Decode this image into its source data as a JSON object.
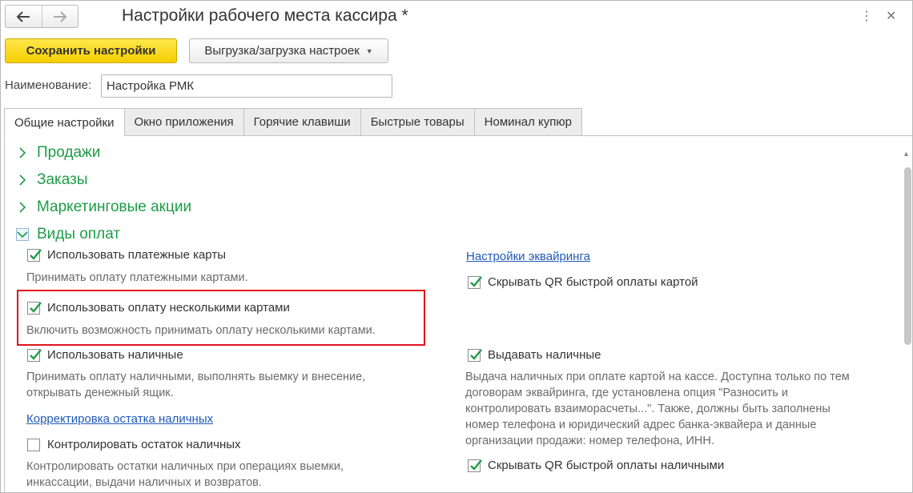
{
  "window": {
    "title": "Настройки рабочего места кассира *",
    "more_glyph": "⋮",
    "close_glyph": "✕"
  },
  "toolbar": {
    "save_label": "Сохранить настройки",
    "export_label": "Выгрузка/загрузка настроек",
    "export_caret": "▼"
  },
  "name_field": {
    "label": "Наименование:",
    "value": "Настройка РМК"
  },
  "tabs": [
    {
      "label": "Общие настройки",
      "active": true
    },
    {
      "label": "Окно приложения"
    },
    {
      "label": "Горячие клавиши"
    },
    {
      "label": "Быстрые товары"
    },
    {
      "label": "Номинал купюр"
    }
  ],
  "groups": {
    "sales": "Продажи",
    "orders": "Заказы",
    "promotions": "Маркетинговые акции",
    "payment_types": "Виды оплат"
  },
  "payment": {
    "use_cards": {
      "label": "Использовать платежные карты",
      "checked": true,
      "hint": "Принимать оплату платежными картами."
    },
    "acquiring_link": "Настройки эквайринга",
    "hide_qr_card": {
      "label": "Скрывать QR быстрой оплаты картой",
      "checked": true
    },
    "multi_cards": {
      "label": "Использовать оплату несколькими картами",
      "checked": true,
      "hint": "Включить возможность принимать оплату несколькими картами."
    },
    "use_cash": {
      "label": "Использовать наличные",
      "checked": true,
      "hint_line1": "Принимать оплату наличными, выполнять выемку и внесение,",
      "hint_line2": "открывать денежный ящик."
    },
    "give_cash": {
      "label": "Выдавать наличные",
      "checked": true,
      "hint_line1": "Выдача наличных при оплате картой на кассе. Доступна только по тем",
      "hint_line2": "договорам эквайринга, где установлена опция \"Разносить и",
      "hint_line3": "контролировать взаиморасчеты...\". Также, должны быть заполнены",
      "hint_line4": "номер телефона и юридический адрес банка-эквайера и данные",
      "hint_line5": "организации продажи: номер телефона, ИНН."
    },
    "cash_correction_link": "Корректировка остатка наличных",
    "control_cash": {
      "label": "Контролировать остаток наличных",
      "checked": false,
      "hint_line1": "Контролировать остатки наличных при операциях выемки,",
      "hint_line2": "инкассации, выдачи наличных и возвратов."
    },
    "hide_qr_cash": {
      "label": "Скрывать QR быстрой оплаты наличными",
      "checked": true
    }
  },
  "colors": {
    "accent_green": "#1e9c47",
    "link_blue": "#1f59b8",
    "save_yellow": "#f4cf00",
    "highlight_red": "#e0131d"
  }
}
